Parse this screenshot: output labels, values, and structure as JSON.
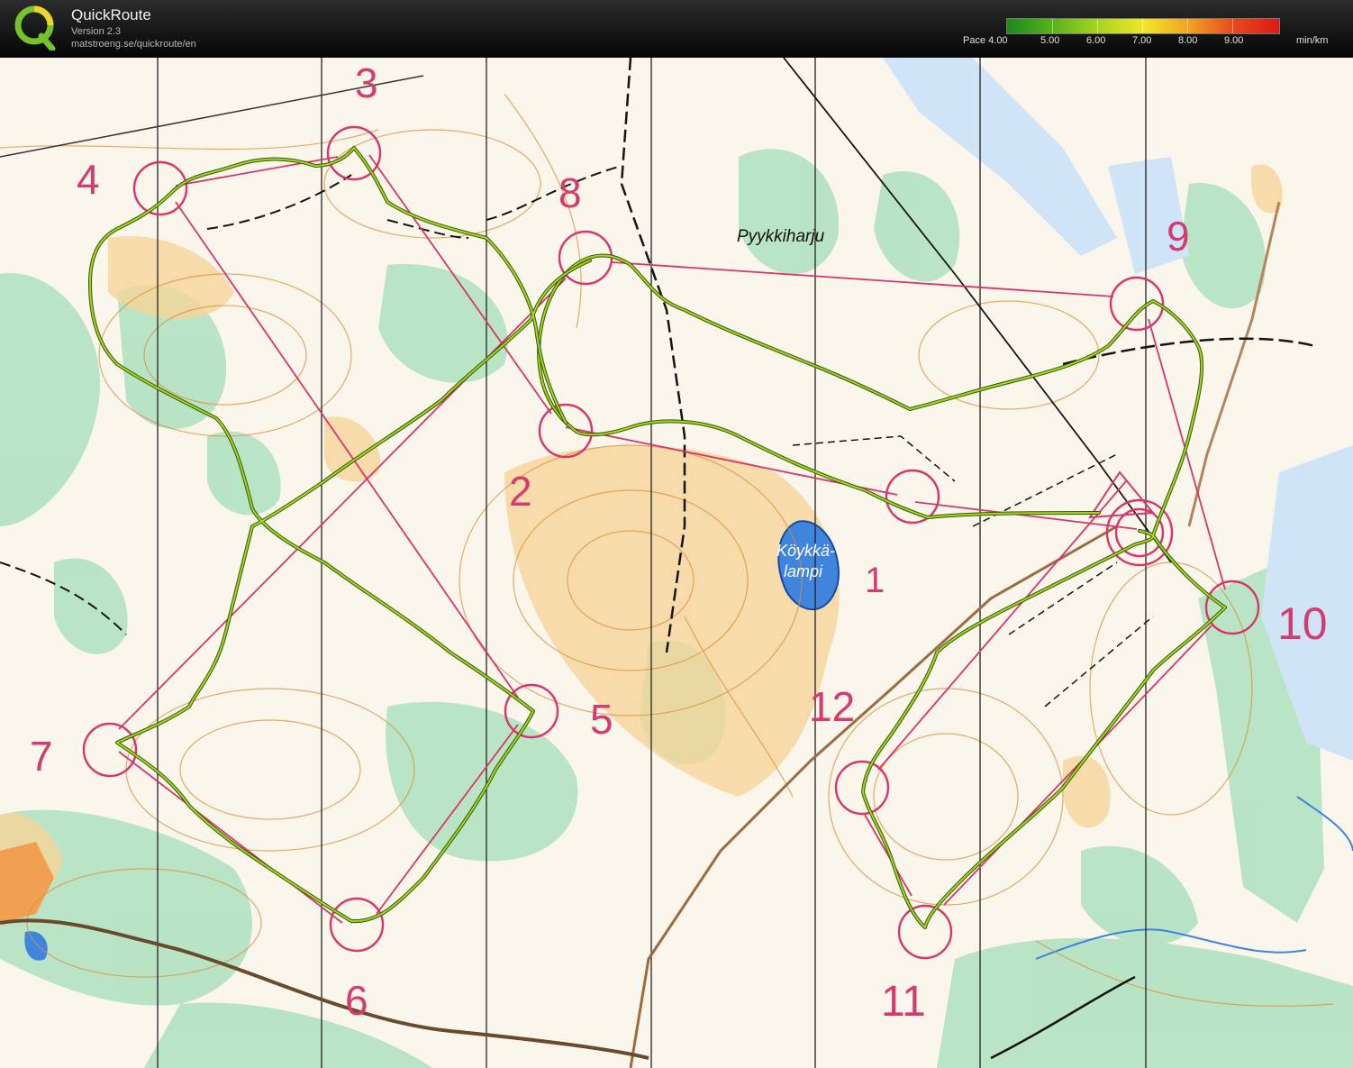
{
  "app": {
    "title": "QuickRoute",
    "version": "Version 2.3",
    "url": "matstroeng.se/quickroute/en"
  },
  "pace_legend": {
    "prefix": "Pace",
    "ticks": [
      "4.00",
      "5.00",
      "6.00",
      "7.00",
      "8.00",
      "9.00"
    ],
    "unit": "min/km",
    "colors": [
      "#1a8a1a",
      "#58b21c",
      "#a8d41e",
      "#f0e628",
      "#f2a322",
      "#e44a1c",
      "#e01818"
    ]
  },
  "map": {
    "place_names": [
      "Pyykkiharju",
      "Köykkä-",
      "lampi"
    ],
    "control_numbers": [
      "1",
      "2",
      "3",
      "4",
      "5",
      "6",
      "7",
      "8",
      "9",
      "10",
      "11",
      "12"
    ],
    "colors": {
      "course": "#d9346b",
      "route": "#5c8f1c",
      "water": "#3f84dd",
      "vegetation": "#aee0bf",
      "open_land": "#f6d59a",
      "contour": "#d9913a",
      "path": "#141414"
    }
  }
}
